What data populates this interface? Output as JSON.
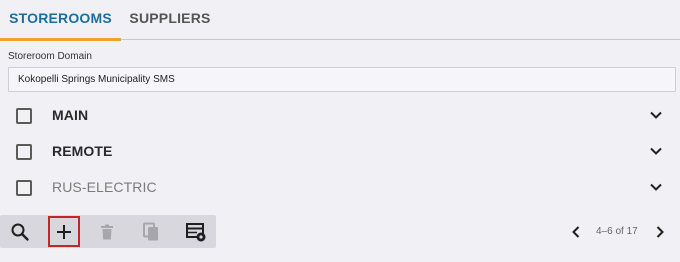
{
  "tabs": [
    {
      "label": "STOREROOMS",
      "active": true
    },
    {
      "label": "SUPPLIERS",
      "active": false
    }
  ],
  "domain": {
    "label": "Storeroom Domain",
    "value": "Kokopelli Springs Municipality SMS"
  },
  "storerooms": [
    {
      "name": "MAIN",
      "checked": false,
      "muted": false
    },
    {
      "name": "REMOTE",
      "checked": false,
      "muted": false
    },
    {
      "name": "RUS-ELECTRIC",
      "checked": false,
      "muted": true
    }
  ],
  "toolbar": {
    "buttons": [
      {
        "icon": "search-icon",
        "enabled": true
      },
      {
        "icon": "plus-icon",
        "enabled": true,
        "highlighted": true
      },
      {
        "icon": "trash-icon",
        "enabled": false
      },
      {
        "icon": "copy-icon",
        "enabled": false
      },
      {
        "icon": "table-settings-icon",
        "enabled": true
      }
    ]
  },
  "pagination": {
    "range": "4–6 of 17"
  },
  "colors": {
    "active_tab": "#1a6fa0",
    "tab_indicator": "#f0a229",
    "highlight_border": "#c2262b",
    "background": "#f1f0f5"
  }
}
